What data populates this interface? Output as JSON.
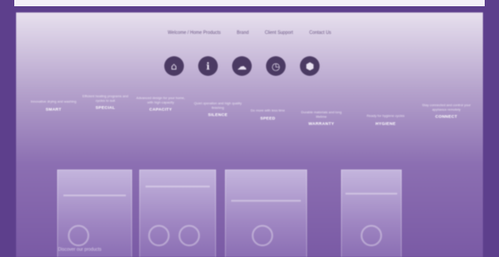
{
  "nav": {
    "items": [
      "Welcome / Home Products",
      "Brand",
      "Client Support",
      "Contact Us"
    ]
  },
  "icons": [
    "home-icon",
    "info-icon",
    "cloud-icon",
    "timer-icon",
    "brand-icon"
  ],
  "icon_glyphs": [
    "⌂",
    "ℹ",
    "☁",
    "◷",
    "⬢"
  ],
  "features": [
    {
      "desc": "Innovative drying and washing",
      "title": "SMART"
    },
    {
      "desc": "Efficient heating programs and cycles to suit",
      "title": "SPECIAL"
    },
    {
      "desc": "Advanced design for your home, with high capacity",
      "title": "CAPACITY"
    },
    {
      "desc": "Quiet operation and high quality finishing",
      "title": "SILENCE"
    },
    {
      "desc": "Do more with less time",
      "title": "SPEED"
    },
    {
      "desc": "Durable materials and long lifetime",
      "title": "WARRANTY"
    },
    {
      "desc": "Ready for hygiene cycles",
      "title": "HYGIENE"
    },
    {
      "desc": "Stay connected and control your appliance remotely",
      "title": "CONNECT"
    }
  ],
  "cards": [
    {
      "name": "card-1"
    },
    {
      "name": "card-2"
    },
    {
      "name": "card-3"
    },
    {
      "name": "card-4"
    }
  ],
  "caption": "Discover our products"
}
